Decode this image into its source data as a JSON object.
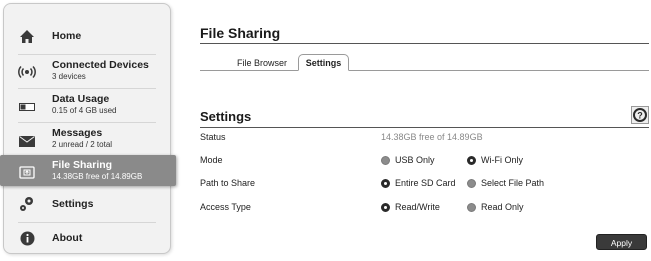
{
  "sidebar": {
    "items": [
      {
        "title": "Home",
        "sub": ""
      },
      {
        "title": "Connected Devices",
        "sub": "3 devices"
      },
      {
        "title": "Data Usage",
        "sub": "0.15 of 4 GB used"
      },
      {
        "title": "Messages",
        "sub": "2 unread / 2 total"
      },
      {
        "title": "File Sharing",
        "sub": "14.38GB free of 14.89GB"
      },
      {
        "title": "Settings",
        "sub": ""
      },
      {
        "title": "About",
        "sub": ""
      }
    ],
    "active_index": 4
  },
  "page": {
    "title": "File Sharing",
    "tabs": [
      {
        "label": "File Browser",
        "active": false
      },
      {
        "label": "Settings",
        "active": true
      }
    ]
  },
  "settings": {
    "title": "Settings",
    "help_icon": "?",
    "status_label": "Status",
    "status_value": "14.38GB free of 14.89GB",
    "mode_label": "Mode",
    "mode_options": [
      {
        "label": "USB Only",
        "selected": false
      },
      {
        "label": "Wi-Fi Only",
        "selected": true
      }
    ],
    "path_label": "Path to Share",
    "path_options": [
      {
        "label": "Entire SD Card",
        "selected": true
      },
      {
        "label": "Select File Path",
        "selected": false
      }
    ],
    "access_label": "Access Type",
    "access_options": [
      {
        "label": "Read/Write",
        "selected": true
      },
      {
        "label": "Read Only",
        "selected": false
      }
    ],
    "apply_label": "Apply"
  },
  "colors": {
    "sidebar_bg": "#f2f2f2",
    "active_bg": "#8a8a8a",
    "apply_bg": "#3a3a3a",
    "radio_off": "#8c8c8c"
  }
}
